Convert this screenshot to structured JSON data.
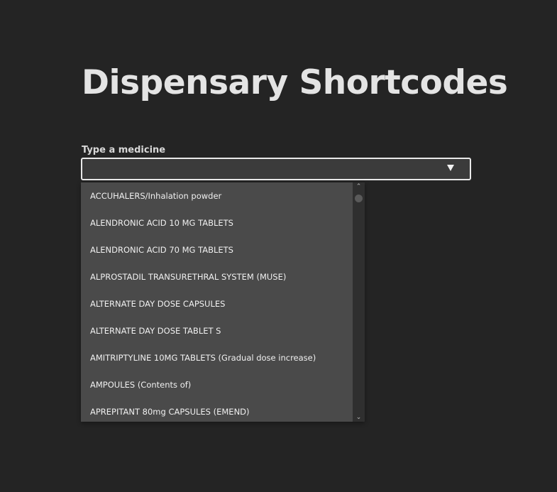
{
  "page": {
    "title": "Dispensary Shortcodes"
  },
  "search": {
    "label": "Type a medicine",
    "value": "",
    "placeholder": ""
  },
  "dropdown": {
    "options": [
      "ACCUHALERS/Inhalation powder",
      "ALENDRONIC ACID 10 MG TABLETS",
      "ALENDRONIC ACID 70 MG TABLETS",
      "ALPROSTADIL TRANSURETHRAL SYSTEM (MUSE)",
      "ALTERNATE DAY DOSE CAPSULES",
      "ALTERNATE DAY DOSE TABLET S",
      "AMITRIPTYLINE 10MG TABLETS (Gradual dose increase)",
      "AMPOULES (Contents of)",
      "APREPITANT 80mg CAPSULES (EMEND)"
    ]
  },
  "icons": {
    "dropdown_arrow": "triangle-down-icon",
    "scroll_up": "chevron-up-icon",
    "scroll_down": "chevron-down-icon"
  },
  "colors": {
    "background": "#242424",
    "title": "#e4e4e4",
    "input_background": "#3b3b3b",
    "input_border": "#e9e9e9",
    "dropdown_background": "#4a4a4a",
    "option_text": "#f0f0f0"
  }
}
